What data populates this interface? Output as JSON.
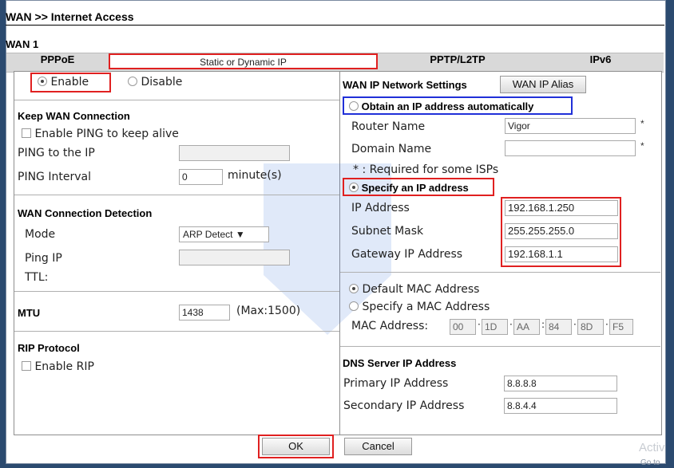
{
  "breadcrumb": "WAN >> Internet Access",
  "section_title": "WAN 1",
  "tabs": [
    {
      "label": "PPPoE"
    },
    {
      "label": "Static or Dynamic IP"
    },
    {
      "label": "PPTP/L2TP"
    },
    {
      "label": "IPv6"
    }
  ],
  "enable": {
    "enable_label": "Enable",
    "disable_label": "Disable"
  },
  "keep_wan": {
    "title": "Keep WAN Connection",
    "ping_keep_alive": "Enable PING to keep alive",
    "ping_to_ip_label": "PING to the IP",
    "ping_to_ip_value": "",
    "ping_interval_label": "PING Interval",
    "ping_interval_value": "0",
    "ping_interval_unit": "minute(s)"
  },
  "detection": {
    "title": "WAN Connection Detection",
    "mode_label": "Mode",
    "mode_value": "ARP Detect",
    "ping_ip_label": "Ping IP",
    "ttl_label": "TTL:"
  },
  "mtu": {
    "label": "MTU",
    "value": "1438",
    "max": "(Max:1500)"
  },
  "rip": {
    "title": "RIP Protocol",
    "enable_label": "Enable RIP"
  },
  "wan_ip": {
    "title": "WAN IP Network Settings",
    "alias_button": "WAN IP Alias",
    "obtain_auto": "Obtain an IP address automatically",
    "router_name_label": "Router Name",
    "router_name_value": "Vigor",
    "domain_name_label": "Domain Name",
    "domain_name_value": "",
    "required_note": "* : Required for some ISPs",
    "star": "*",
    "specify": "Specify an IP address",
    "ip_label": "IP Address",
    "ip_value": "192.168.1.250",
    "mask_label": "Subnet Mask",
    "mask_value": "255.255.255.0",
    "gateway_label": "Gateway IP Address",
    "gateway_value": "192.168.1.1"
  },
  "mac": {
    "default": "Default MAC Address",
    "specify": "Specify a MAC Address",
    "label": "MAC Address:",
    "octets": [
      "00",
      "1D",
      "AA",
      "84",
      "8D",
      "F5"
    ]
  },
  "dns": {
    "title": "DNS Server IP Address",
    "primary_label": "Primary IP Address",
    "primary_value": "8.8.8.8",
    "secondary_label": "Secondary IP Address",
    "secondary_value": "8.8.4.4"
  },
  "buttons": {
    "ok": "OK",
    "cancel": "Cancel"
  },
  "overlay": {
    "activate": "Activ",
    "goto": "Go to"
  },
  "colors": {
    "highlight_red": "#e02020",
    "highlight_blue": "#2030d8",
    "background": "#2b4a6f"
  }
}
